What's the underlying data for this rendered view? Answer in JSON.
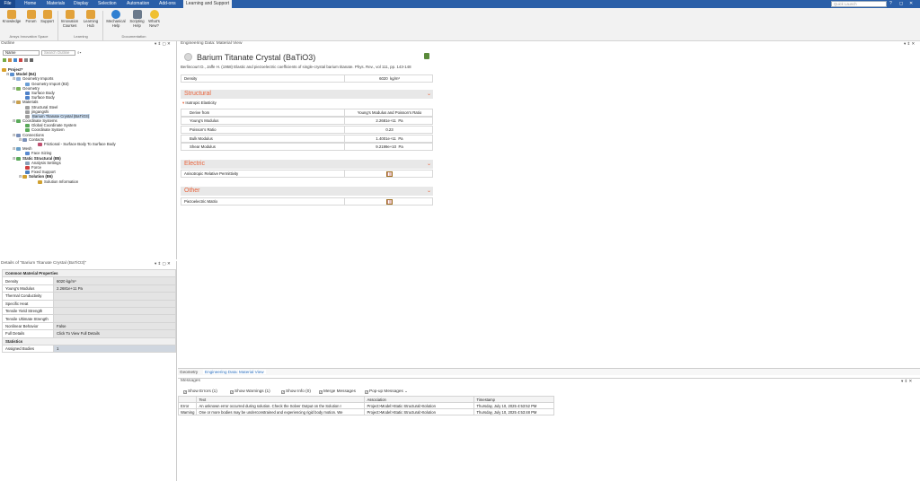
{
  "menubar": {
    "file": "File",
    "tabs": [
      "Home",
      "Materials",
      "Display",
      "Selection",
      "Automation",
      "Add-ons",
      "Learning and Support"
    ],
    "quick_launch_placeholder": "Quick Launch",
    "window_controls": [
      "?",
      "◻",
      "✕"
    ]
  },
  "ribbon": {
    "buttons": [
      "Knowledge",
      "Forum",
      "Support",
      "Innovation Courses",
      "Learning Hub",
      "Mechanical Help",
      "Scripting Help",
      "What's New?"
    ],
    "groups": [
      "Ansys Innovation Space",
      "Learning",
      "Documentation"
    ]
  },
  "outline": {
    "title": "Outline",
    "filter_value": "Name",
    "search_placeholder": "Search Outline",
    "tree": [
      {
        "label": "Project*",
        "bold": true
      },
      {
        "label": "Model (B4)",
        "bold": true
      },
      {
        "label": "Geometry Imports"
      },
      {
        "label": "Geometry Import (B3)"
      },
      {
        "label": "Geometry"
      },
      {
        "label": "Surface Body"
      },
      {
        "label": "Surface Body"
      },
      {
        "label": "Materials"
      },
      {
        "label": "Structural Steel"
      },
      {
        "label": "jingangshi"
      },
      {
        "label": "Barium Titanate Crystal (BaTiO3)",
        "selected": true
      },
      {
        "label": "Coordinate Systems"
      },
      {
        "label": "Global Coordinate System"
      },
      {
        "label": "Coordinate System"
      },
      {
        "label": "Connections"
      },
      {
        "label": "Contacts"
      },
      {
        "label": "Frictional - Surface Body To Surface Body"
      },
      {
        "label": "Mesh"
      },
      {
        "label": "Face Sizing"
      },
      {
        "label": "Static Structural (B5)",
        "bold": true
      },
      {
        "label": "Analysis Settings"
      },
      {
        "label": "Force"
      },
      {
        "label": "Fixed Support"
      },
      {
        "label": "Solution (B6)",
        "bold": true
      },
      {
        "label": "Solution Information"
      }
    ]
  },
  "details": {
    "title": "Details of \"Barium Titanate Crystal (BaTiO3)\"",
    "section_common": "Common Material Properties",
    "rows": [
      {
        "label": "Density",
        "value": "6020 kg/m³"
      },
      {
        "label": "Young's Modulus",
        "value": "2.2681e+11 Pa"
      },
      {
        "label": "Thermal Conductivity",
        "value": ""
      },
      {
        "label": "Specific Heat",
        "value": ""
      },
      {
        "label": "Tensile Yield Strength",
        "value": ""
      },
      {
        "label": "Tensile Ultimate Strength",
        "value": ""
      },
      {
        "label": "Nonlinear Behavior",
        "value": "False"
      },
      {
        "label": "Full Details",
        "value": "Click To View Full Details"
      }
    ],
    "section_stats": "Statistics",
    "stats_rows": [
      {
        "label": "Assigned Bodies",
        "value": "1"
      }
    ]
  },
  "engineering": {
    "panel_title": "Engineering Data: Material View",
    "material_name": "Barium Titanate Crystal (BaTiO3)",
    "citation": "Berlincourt D., Jaffe H. (1958) Elastic and piezoelectric coefficients of single-crystal barium titanate. Phys. Rev., vol 111, pp. 143-148",
    "density": {
      "label": "Density",
      "value": "6020",
      "unit": "kg/m³"
    },
    "structural": {
      "title": "Structural",
      "sub": "Isotropic Elasticity",
      "rows": [
        {
          "label": "Derive from",
          "value": "Young's Modulus and Poisson's Ratio",
          "unit": ""
        },
        {
          "label": "Young's Modulus",
          "value": "2.2681e+11",
          "unit": "Pa"
        },
        {
          "label": "Poisson's Ratio",
          "value": "0.23",
          "unit": ""
        },
        {
          "label": "Bulk Modulus",
          "value": "1.4001e+11",
          "unit": "Pa"
        },
        {
          "label": "Shear Modulus",
          "value": "9.2199e+10",
          "unit": "Pa"
        }
      ]
    },
    "electric": {
      "title": "Electric",
      "row": "Anisotropic Relative Permittivity"
    },
    "other": {
      "title": "Other",
      "row": "Piezoelectric Matrix"
    }
  },
  "bottom_tabs": [
    "Geometry",
    "Engineering Data: Material View"
  ],
  "messages": {
    "title": "Messages",
    "filters": [
      {
        "label": "Show Errors",
        "count": "(1)"
      },
      {
        "label": "Show Warnings",
        "count": "(1)"
      },
      {
        "label": "Show Info",
        "count": "(0)"
      },
      {
        "label": "Merge Messages",
        "count": ""
      },
      {
        "label": "Pop-up Messages",
        "count": ""
      }
    ],
    "columns": [
      "",
      "Text",
      "Association",
      "Timestamp"
    ],
    "rows": [
      [
        "Error",
        "An unknown error occurred during solution.  Check the Solver Output on the Solution I",
        "Project>Model>Static Structural>Solution",
        "Thursday, July 10, 2025 4:53:52 PM"
      ],
      [
        "Warning",
        "One or more bodies may be underconstrained and experiencing rigid body motion. We",
        "Project>Model>Static Structural>Solution",
        "Thursday, July 10, 2025 4:53:48 PM"
      ]
    ]
  },
  "colors": {
    "menubar": "#2a5fa8",
    "accent_orange": "#e8623a",
    "link_blue": "#2a6fbf"
  }
}
